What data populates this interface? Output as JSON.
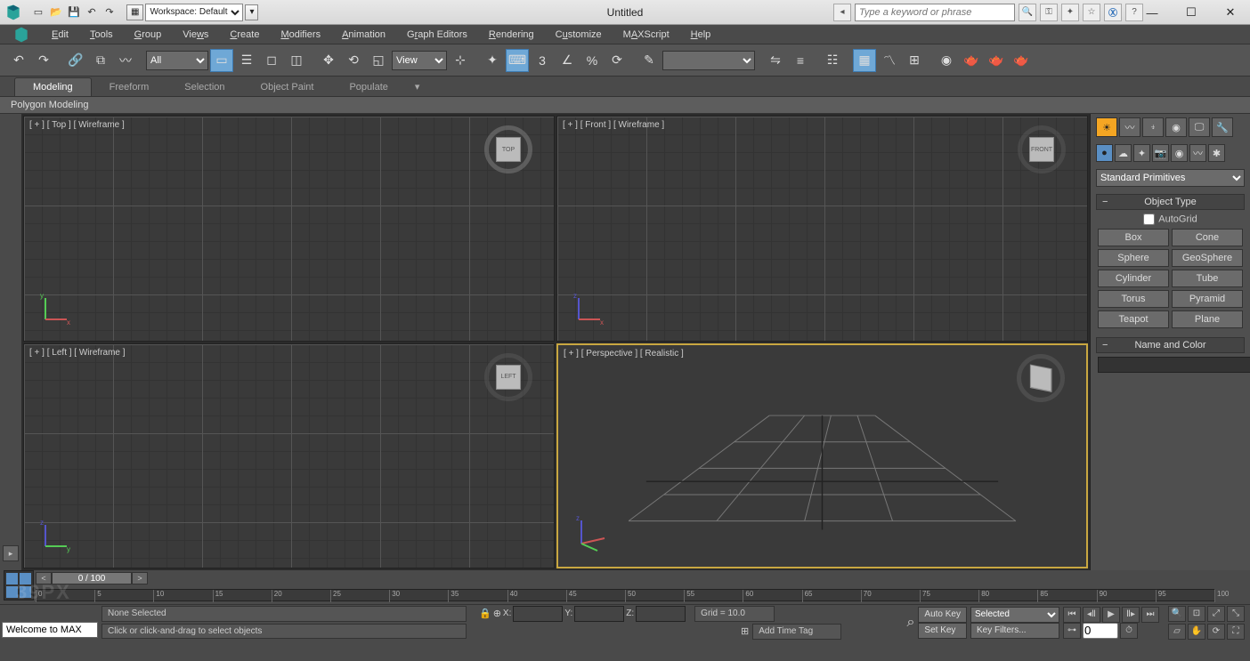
{
  "titlebar": {
    "workspace_label": "Workspace: Default",
    "title": "Untitled",
    "search_placeholder": "Type a keyword or phrase"
  },
  "menu": {
    "items": [
      "Edit",
      "Tools",
      "Group",
      "Views",
      "Create",
      "Modifiers",
      "Animation",
      "Graph Editors",
      "Rendering",
      "Customize",
      "MAXScript",
      "Help"
    ]
  },
  "toolbar": {
    "filter_all": "All",
    "refsys": "View",
    "angle_snap": "3"
  },
  "ribbon": {
    "tabs": [
      "Modeling",
      "Freeform",
      "Selection",
      "Object Paint",
      "Populate"
    ],
    "active": 0,
    "panel_label": "Polygon Modeling"
  },
  "viewports": {
    "tl": "[ + ] [ Top ]  [ Wireframe ]",
    "tr": "[ + ] [ Front ]  [ Wireframe ]",
    "bl": "[ + ] [ Left ]  [ Wireframe ]",
    "br": "[ + ] [ Perspective ]  [ Realistic ]",
    "cube_tl": "TOP",
    "cube_tr": "FRONT",
    "cube_bl": "LEFT"
  },
  "cmdpanel": {
    "category": "Standard Primitives",
    "rollout_objtype": "Object Type",
    "autogrid_label": "AutoGrid",
    "buttons": [
      "Box",
      "Cone",
      "Sphere",
      "GeoSphere",
      "Cylinder",
      "Tube",
      "Torus",
      "Pyramid",
      "Teapot",
      "Plane"
    ],
    "rollout_namecolor": "Name and Color"
  },
  "timeline": {
    "frame_label": "0 / 100",
    "ticks": [
      "0",
      "5",
      "10",
      "15",
      "20",
      "25",
      "30",
      "35",
      "40",
      "45",
      "50",
      "55",
      "60",
      "65",
      "70",
      "75",
      "80",
      "85",
      "90",
      "95",
      "100"
    ]
  },
  "status": {
    "welcome": "Welcome to MAX",
    "selection": "None Selected",
    "prompt": "Click or click-and-drag to select objects",
    "x": "X:",
    "y": "Y:",
    "z": "Z:",
    "grid": "Grid = 10.0",
    "add_time_tag": "Add Time Tag",
    "auto_key": "Auto Key",
    "set_key": "Set Key",
    "selected": "Selected",
    "key_filters": "Key Filters...",
    "frame_field": "0"
  },
  "watermark": "39PX"
}
